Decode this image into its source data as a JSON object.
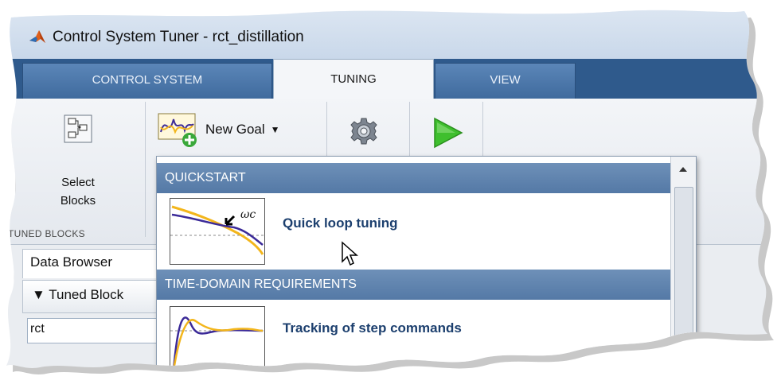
{
  "window": {
    "title": "Control System Tuner - rct_distillation"
  },
  "tabs": [
    {
      "label": "CONTROL SYSTEM",
      "active": false
    },
    {
      "label": "TUNING",
      "active": true
    },
    {
      "label": "VIEW",
      "active": false
    }
  ],
  "toolstrip": {
    "select_blocks": {
      "line1": "Select",
      "line2": "Blocks",
      "icon": "select-blocks-icon"
    },
    "new_goal": {
      "label": "New Goal",
      "icon": "new-goal-icon"
    },
    "options_icon": "gear-icon",
    "tune_icon": "play-icon",
    "section_label": "TUNED BLOCKS"
  },
  "left_panel": {
    "browser_label": "Data Browser",
    "tuned_header": "▼ Tuned Block",
    "row_text": "rct"
  },
  "menu": {
    "sections": [
      {
        "label": "QUICKSTART"
      },
      {
        "label": "TIME-DOMAIN REQUIREMENTS"
      }
    ],
    "items": [
      {
        "label": "Quick loop tuning",
        "thumb_text": "ωc"
      },
      {
        "label": "Tracking of step commands"
      }
    ]
  },
  "colors": {
    "tab_strip": "#2f5a8c",
    "section_header": "#5a7eab",
    "item_link": "#1c3f6e",
    "curve_purple": "#3b2a98",
    "curve_yellow": "#f3b61c"
  }
}
